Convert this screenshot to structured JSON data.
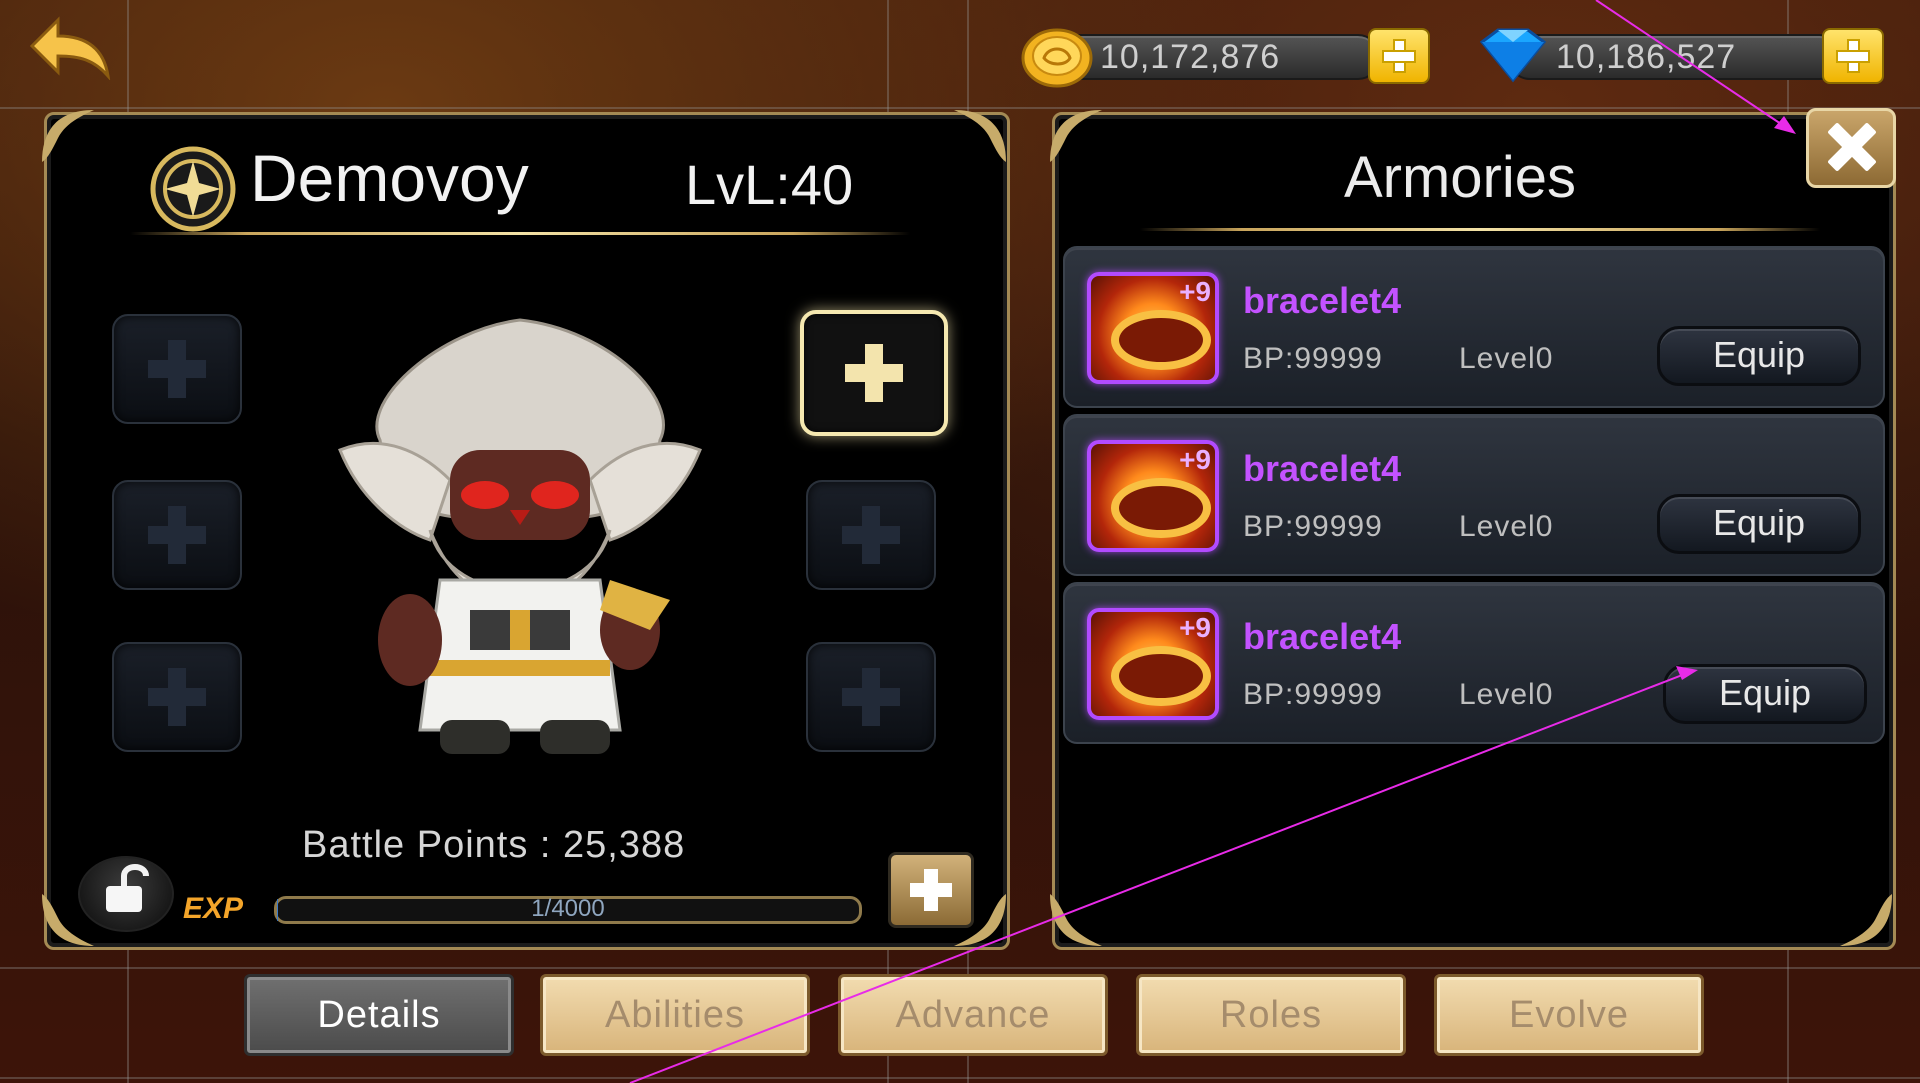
{
  "currency": {
    "gold": "10,172,876",
    "gems": "10,186,527"
  },
  "character": {
    "name": "Demovoy",
    "level": "LvL:40",
    "battle_points": "Battle Points : 25,388",
    "exp_label": "EXP",
    "exp_text": "1/4000",
    "exp_fraction": 0.00025
  },
  "armories": {
    "title": "Armories",
    "items": [
      {
        "name": "bracelet4",
        "plus": "+9",
        "bp": "BP:99999",
        "level": "Level0",
        "action": "Equip"
      },
      {
        "name": "bracelet4",
        "plus": "+9",
        "bp": "BP:99999",
        "level": "Level0",
        "action": "Equip"
      },
      {
        "name": "bracelet4",
        "plus": "+9",
        "bp": "BP:99999",
        "level": "Level0",
        "action": "Equip"
      }
    ]
  },
  "tabs": [
    "Details",
    "Abilities",
    "Advance",
    "Roles",
    "Evolve"
  ],
  "active_tab": "Details",
  "colors": {
    "item_name": "#c352ff",
    "exp_label": "#f4a52a",
    "annotation": "#e82be8"
  },
  "icons": {
    "back": "back-arrow-icon",
    "gold": "gold-coin-icon",
    "gems": "diamond-icon",
    "add": "plus-icon",
    "close": "close-icon",
    "lock": "unlock-icon"
  }
}
